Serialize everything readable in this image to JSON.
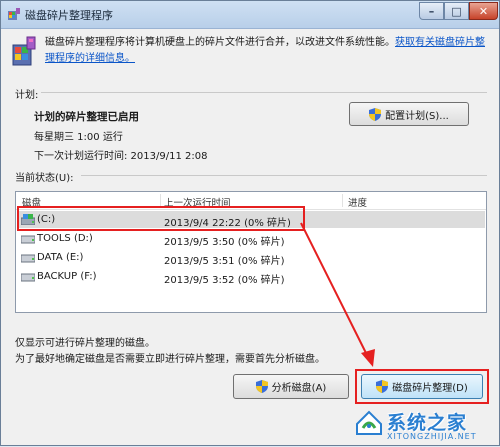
{
  "window": {
    "title": "磁盘碎片整理程序"
  },
  "intro": {
    "text": "磁盘碎片整理程序将计算机硬盘上的碎片文件进行合并，以改进文件系统性能。",
    "link": "获取有关磁盘碎片整理程序的详细信息。"
  },
  "schedule": {
    "section_label": "计划:",
    "status": "计划的碎片整理已启用",
    "run_time": "每星期三 1:00 运行",
    "next_run": "下一次计划运行时间: 2013/9/11 2:08",
    "configure_button": "配置计划(S)..."
  },
  "current_status": {
    "section_label": "当前状态(U):",
    "columns": [
      "磁盘",
      "上一次运行时间",
      "进度"
    ],
    "rows": [
      {
        "disk": "(C:)",
        "last_run": "2013/9/4 22:22 (0% 碎片)",
        "progress": ""
      },
      {
        "disk": "TOOLS (D:)",
        "last_run": "2013/9/5 3:50 (0% 碎片)",
        "progress": ""
      },
      {
        "disk": "DATA (E:)",
        "last_run": "2013/9/5 3:51 (0% 碎片)",
        "progress": ""
      },
      {
        "disk": "BACKUP (F:)",
        "last_run": "2013/9/5 3:52 (0% 碎片)",
        "progress": ""
      }
    ]
  },
  "notes": {
    "line1": "仅显示可进行碎片整理的磁盘。",
    "line2": "为了最好地确定磁盘是否需要立即进行碎片整理，需要首先分析磁盘。"
  },
  "buttons": {
    "analyze": "分析磁盘(A)",
    "defrag": "磁盘碎片整理(D)"
  },
  "watermark": {
    "main": "系统之家",
    "sub": "XITONGZHIJIA.NET"
  },
  "colors": {
    "annotation": "#e52020",
    "link": "#0a55c8"
  }
}
